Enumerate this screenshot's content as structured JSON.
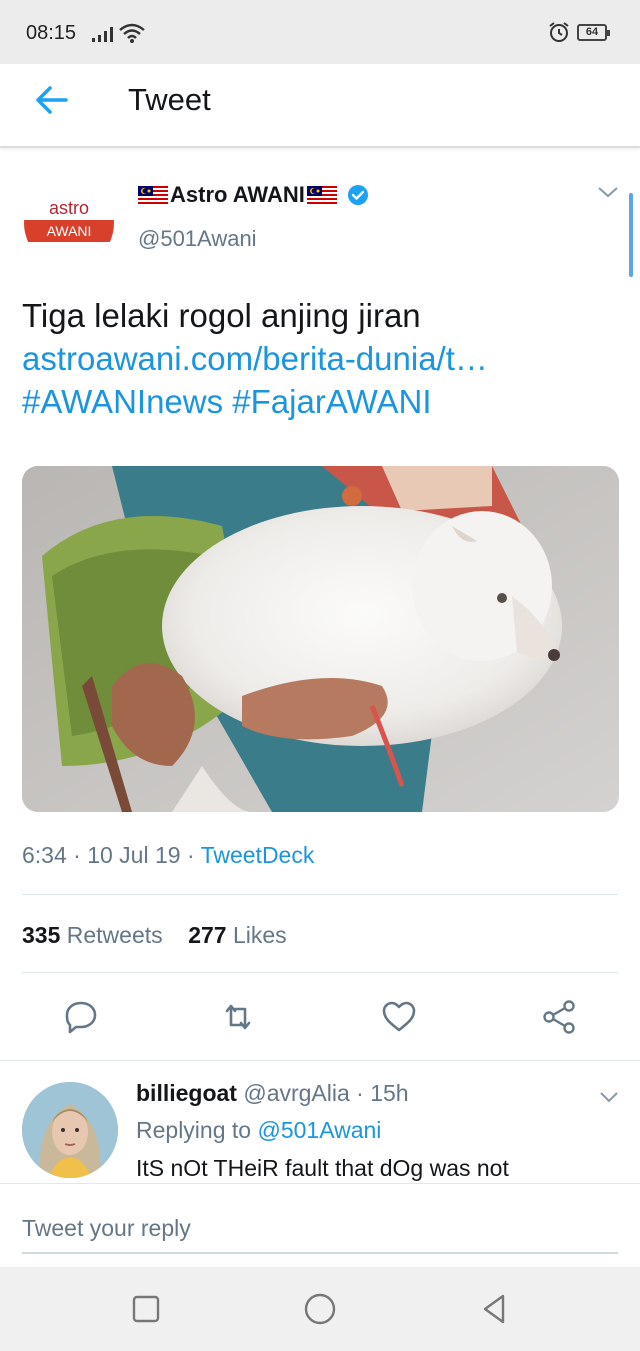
{
  "status_bar": {
    "time": "08:15",
    "battery": "64",
    "icons": [
      "signal-icon",
      "wifi-icon",
      "alarm-icon",
      "battery-icon"
    ]
  },
  "app_bar": {
    "back_icon": "arrow-left-icon",
    "title": "Tweet"
  },
  "tweet": {
    "avatar": {
      "top": "astro",
      "bottom": "AWANI"
    },
    "author_name": "Astro AWANI",
    "author_handle": "@501Awani",
    "text": "Tiga lelaki rogol anjing jiran",
    "link": "astroawani.com/berita-dunia/t…",
    "hashtags": [
      "#AWANInews",
      "#FajarAWANI"
    ],
    "time": "6:34 · 10 Jul 19 · ",
    "source": "TweetDeck",
    "retweets_count": "335",
    "retweets_label": "Retweets",
    "likes_count": "277",
    "likes_label": "Likes",
    "actions": [
      "reply-icon",
      "retweet-icon",
      "like-icon",
      "share-icon"
    ]
  },
  "reply": {
    "name": "billiegoat",
    "handle_time": " @avrgAlia · 15h",
    "replying_prefix": "Replying to ",
    "replying_to": "@501Awani",
    "text": "ItS nOt THeiR fault that dOg was not"
  },
  "compose": {
    "placeholder": "Tweet your reply"
  },
  "colors": {
    "accent": "#1b95e0",
    "text_primary": "#14171a",
    "text_secondary": "#657786",
    "divider": "#e1e8ed"
  }
}
